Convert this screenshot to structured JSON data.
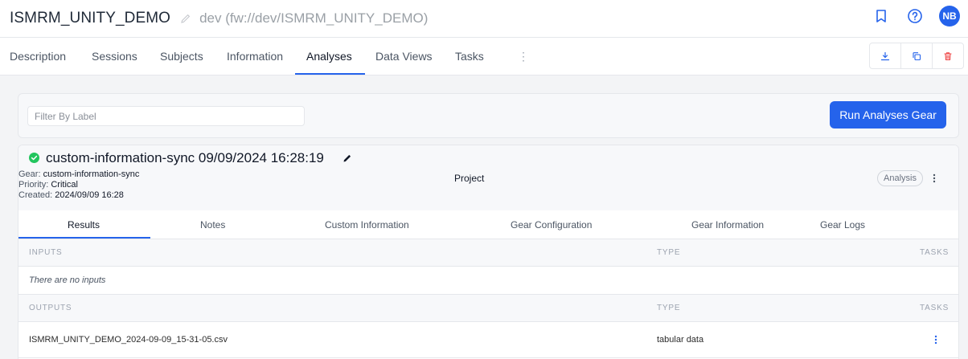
{
  "header": {
    "project_title": "ISMRM_UNITY_DEMO",
    "project_path": "dev (fw://dev/ISMRM_UNITY_DEMO)",
    "avatar_initials": "NB"
  },
  "tabs": [
    "Description",
    "Sessions",
    "Subjects",
    "Information",
    "Analyses",
    "Data Views",
    "Tasks"
  ],
  "active_tab": "Analyses",
  "filter": {
    "placeholder": "Filter By Label",
    "value": ""
  },
  "run_button_label": "Run Analyses Gear",
  "analysis": {
    "title": "custom-information-sync 09/09/2024 16:28:19",
    "gear_label": "Gear:",
    "gear_value": "custom-information-sync",
    "priority_label": "Priority:",
    "priority_value": "Critical",
    "created_label": "Created:",
    "created_value": "2024/09/09 16:28",
    "container": "Project",
    "badge": "Analysis",
    "status_color": "#22c55e"
  },
  "sub_tabs": [
    "Results",
    "Notes",
    "Custom Information",
    "Gear Configuration",
    "Gear Information",
    "Gear Logs"
  ],
  "active_sub_tab": "Results",
  "inputs_section": {
    "heading": "INPUTS",
    "type_heading": "TYPE",
    "tasks_heading": "TASKS",
    "empty_text": "There are no inputs"
  },
  "outputs_section": {
    "heading": "OUTPUTS",
    "type_heading": "TYPE",
    "tasks_heading": "TASKS",
    "rows": [
      {
        "name": "ISMRM_UNITY_DEMO_2024-09-09_15-31-05.csv",
        "type": "tabular data"
      }
    ]
  },
  "colors": {
    "accent": "#2563eb",
    "success": "#22c55e",
    "danger": "#ef4444"
  }
}
